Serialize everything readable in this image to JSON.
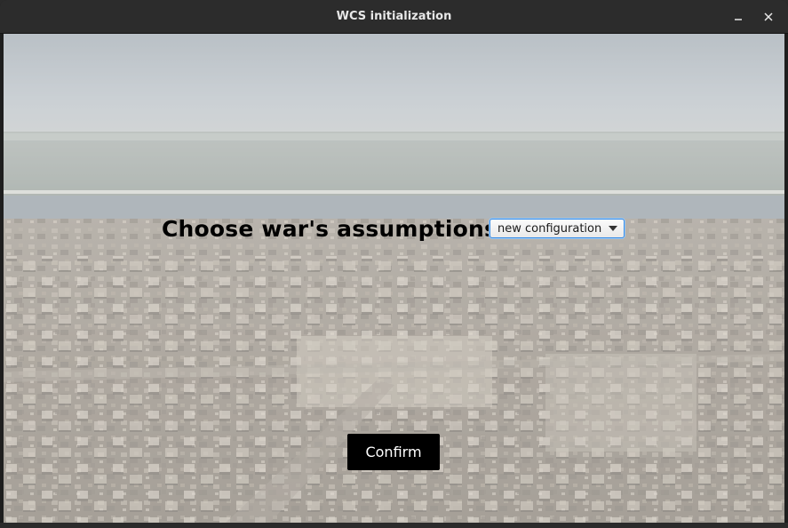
{
  "window": {
    "title": "WCS initialization",
    "minimize_icon": "minimize-icon",
    "close_icon": "close-icon"
  },
  "main": {
    "heading": "Choose war's assumptions",
    "config_select": {
      "selected": "new configuration",
      "icon": "chevron-down-icon",
      "accent": "#3a8ee6"
    },
    "confirm_label": "Confirm",
    "background": {
      "subject": "aerial photo of a ruined city beside a river",
      "sky": "#b9c0c6",
      "river": "#8c979d",
      "ruins": "#a89c8d"
    }
  },
  "colors": {
    "titlebar": "#2c2c2c",
    "title_text": "#e8e8e8",
    "button_bg": "#000000",
    "button_text": "#ffffff"
  }
}
